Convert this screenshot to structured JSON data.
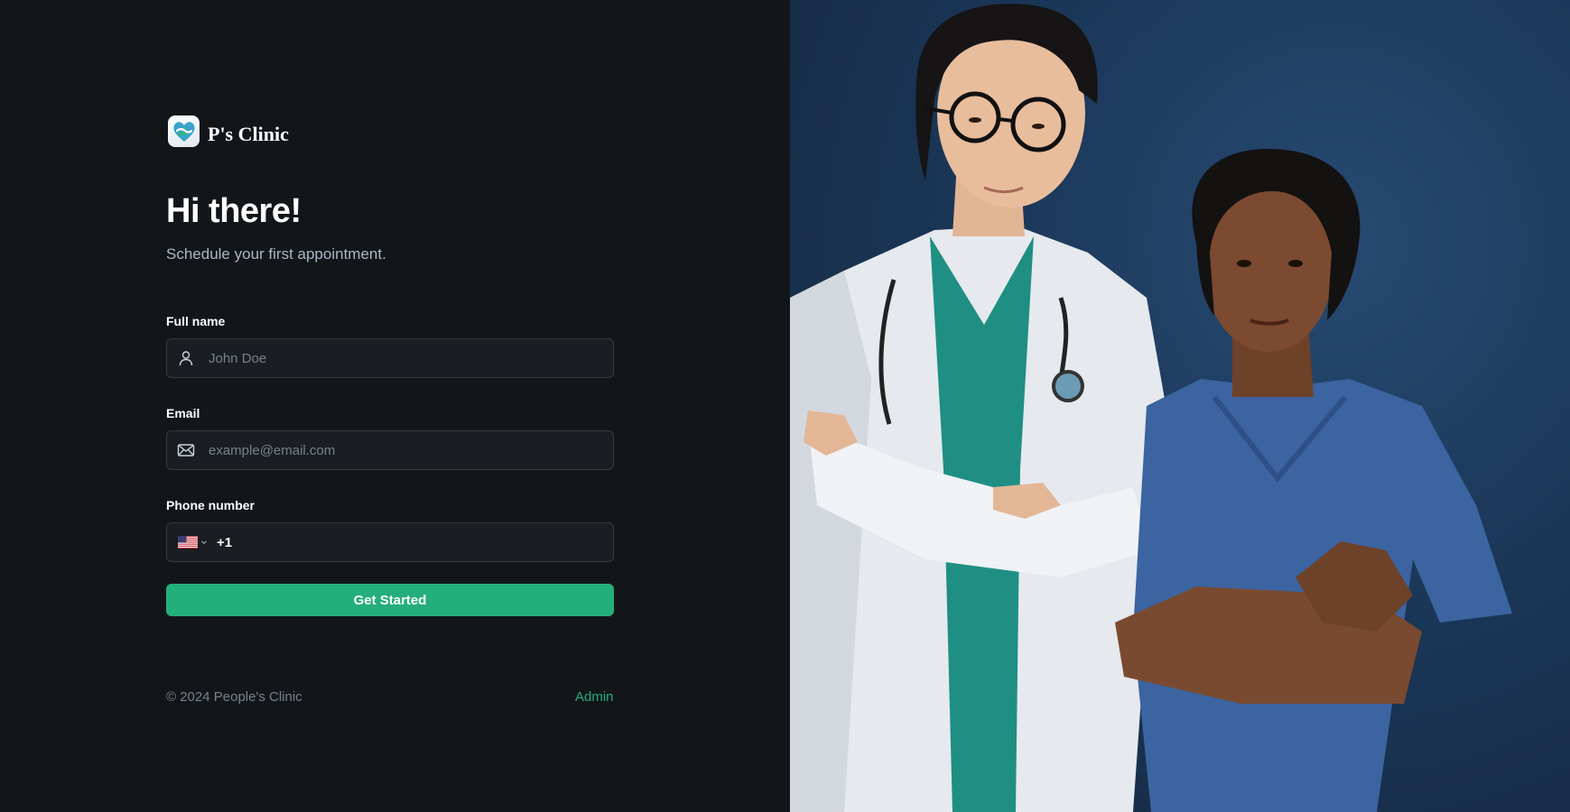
{
  "brand": {
    "name": "P's Clinic",
    "logo_icon": "heart-hands-logo-icon"
  },
  "hero": {
    "title": "Hi there!",
    "subtitle": "Schedule your first appointment."
  },
  "form": {
    "full_name": {
      "label": "Full name",
      "placeholder": "John Doe",
      "icon": "user-icon"
    },
    "email": {
      "label": "Email",
      "placeholder": "example@email.com",
      "icon": "mail-icon"
    },
    "phone": {
      "label": "Phone number",
      "country_flag": "us-flag-icon",
      "dial_code": "+1",
      "value": ""
    },
    "submit_label": "Get Started"
  },
  "footer": {
    "copyright": "© 2024 People's Clinic",
    "admin_link": "Admin"
  },
  "colors": {
    "background": "#131619",
    "accent": "#24ae7c",
    "input_bg": "#1a1d21",
    "input_border": "#363a3d",
    "muted_text": "#76828d",
    "photo_background": "#1b3758"
  },
  "image": {
    "description_icon": "doctor-and-nurse-photo"
  }
}
